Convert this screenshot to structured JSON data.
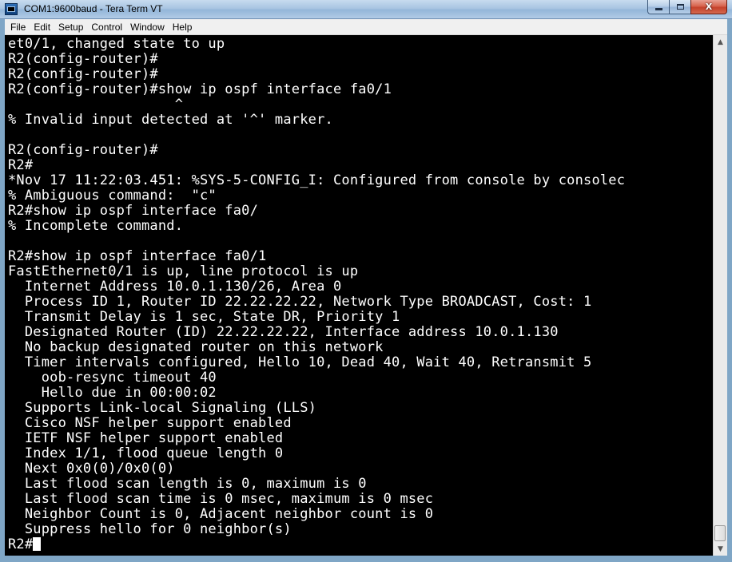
{
  "window": {
    "title": "COM1:9600baud - Tera Term VT"
  },
  "menu": {
    "items": [
      "File",
      "Edit",
      "Setup",
      "Control",
      "Window",
      "Help"
    ]
  },
  "caption": {
    "close_label": "X"
  },
  "terminal": {
    "lines": [
      "et0/1, changed state to up",
      "R2(config-router)#",
      "R2(config-router)#",
      "R2(config-router)#show ip ospf interface fa0/1",
      "                    ^",
      "% Invalid input detected at '^' marker.",
      "",
      "R2(config-router)#",
      "R2#",
      "*Nov 17 11:22:03.451: %SYS-5-CONFIG_I: Configured from console by consolec",
      "% Ambiguous command:  \"c\"",
      "R2#show ip ospf interface fa0/",
      "% Incomplete command.",
      "",
      "R2#show ip ospf interface fa0/1",
      "FastEthernet0/1 is up, line protocol is up",
      "  Internet Address 10.0.1.130/26, Area 0",
      "  Process ID 1, Router ID 22.22.22.22, Network Type BROADCAST, Cost: 1",
      "  Transmit Delay is 1 sec, State DR, Priority 1",
      "  Designated Router (ID) 22.22.22.22, Interface address 10.0.1.130",
      "  No backup designated router on this network",
      "  Timer intervals configured, Hello 10, Dead 40, Wait 40, Retransmit 5",
      "    oob-resync timeout 40",
      "    Hello due in 00:00:02",
      "  Supports Link-local Signaling (LLS)",
      "  Cisco NSF helper support enabled",
      "  IETF NSF helper support enabled",
      "  Index 1/1, flood queue length 0",
      "  Next 0x0(0)/0x0(0)",
      "  Last flood scan length is 0, maximum is 0",
      "  Last flood scan time is 0 msec, maximum is 0 msec",
      "  Neighbor Count is 0, Adjacent neighbor count is 0",
      "  Suppress hello for 0 neighbor(s)"
    ],
    "prompt": "R2#"
  }
}
